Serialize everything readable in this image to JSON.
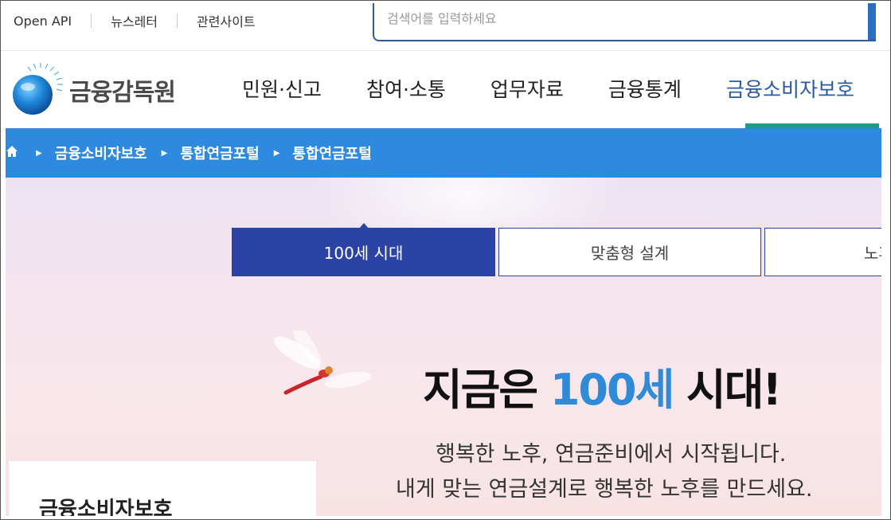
{
  "utility": {
    "links": [
      "Open API",
      "뉴스레터",
      "관련사이트"
    ],
    "search_placeholder": "검색어를 입력하세요"
  },
  "header": {
    "logo_text": "금융감독원",
    "menu": [
      "민원·신고",
      "참여·소통",
      "업무자료",
      "금융통계",
      "금융소비자보호"
    ],
    "active_menu_index": 4
  },
  "breadcrumb": {
    "items": [
      "금융소비자보호",
      "통합연금포털",
      "통합연금포털"
    ]
  },
  "hero": {
    "tabs": [
      "100세 시대",
      "맞춤형 설계",
      "노후"
    ],
    "active_tab_index": 0,
    "headline_part1": "지금은 ",
    "headline_highlight": "100세",
    "headline_part2": " 시대!",
    "subtitle_line1": "행복한 노후, 연금준비에서 시작됩니다.",
    "subtitle_line2": "내게 맞는 연금설계로 행복한 노후를 만드세요.",
    "side_title": "금융소비자보호"
  },
  "colors": {
    "primary_blue": "#2e8adf",
    "tab_active": "#2c43a6",
    "highlight": "#2f8ad8",
    "menu_active": "#2c5aa0",
    "menu_underline": "#1f9a8a"
  }
}
